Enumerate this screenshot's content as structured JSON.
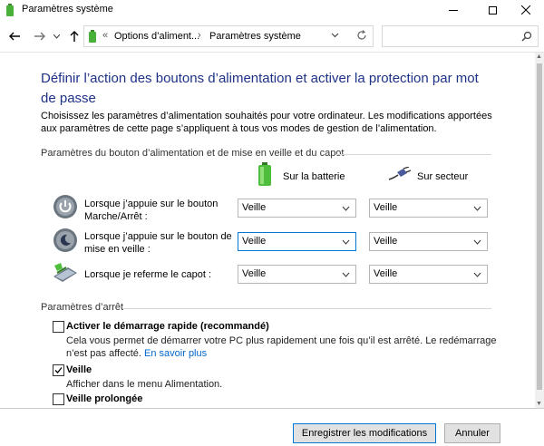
{
  "window": {
    "title": "Paramètres système"
  },
  "breadcrumb": {
    "items": [
      "Options d’aliment...",
      "Paramètres système"
    ]
  },
  "main": {
    "heading": "Définir l’action des boutons d’alimentation et activer la protection par mot de passe",
    "description": "Choisissez les paramètres d’alimentation souhaités pour votre ordinateur. Les modifications apportées aux paramètres de cette page s’appliquent à tous vos modes de gestion de l’alimentation.",
    "power_section_label": "Paramètres du bouton d’alimentation et de mise en veille et du capot",
    "col_battery": "Sur la batterie",
    "col_ac": "Sur secteur",
    "rows": [
      {
        "label": "Lorsque j’appuie sur le bouton Marche/Arrêt :",
        "battery": "Veille",
        "ac": "Veille"
      },
      {
        "label": "Lorsque j’appuie sur le bouton de mise en veille :",
        "battery": "Veille",
        "ac": "Veille"
      },
      {
        "label": "Lorsque je referme le capot :",
        "battery": "Veille",
        "ac": "Veille"
      }
    ],
    "shutdown_section_label": "Paramètres d’arrêt",
    "fast_startup": {
      "label": "Activer le démarrage rapide (recommandé)",
      "desc_text": "Cela vous permet de démarrer votre PC plus rapidement une fois qu’il est arrêté. Le redémarrage n’est pas affecté.",
      "link": "En savoir plus",
      "checked": false
    },
    "sleep": {
      "label": "Veille",
      "desc": "Afficher dans le menu Alimentation.",
      "checked": true
    },
    "hibernate": {
      "label": "Veille prolongée",
      "checked": false
    }
  },
  "footer": {
    "save_label": "Enregistrer les modifications",
    "cancel_label": "Annuler"
  }
}
